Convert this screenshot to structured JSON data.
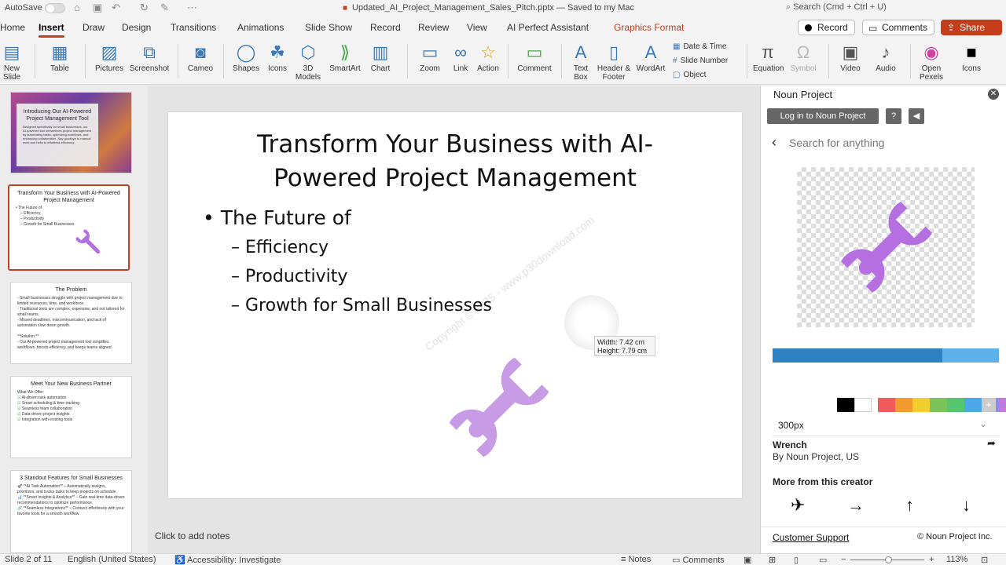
{
  "titlebar": {
    "autosave_label": "AutoSave",
    "doc_title": "Updated_AI_Project_Management_Sales_Pitch.pptx",
    "save_status": "— Saved to my Mac",
    "search_placeholder": "Search (Cmd + Ctrl + U)"
  },
  "tabs": [
    "Home",
    "Insert",
    "Draw",
    "Design",
    "Transitions",
    "Animations",
    "Slide Show",
    "Record",
    "Review",
    "View",
    "AI Perfect Assistant",
    "Graphics Format"
  ],
  "active_tab": "Insert",
  "actions": {
    "record": "Record",
    "comments": "Comments",
    "share": "Share"
  },
  "ribbon": {
    "new_slide": "New\nSlide",
    "table": "Table",
    "pictures": "Pictures",
    "screenshot": "Screenshot",
    "cameo": "Cameo",
    "shapes": "Shapes",
    "icons": "Icons",
    "models3d": "3D\nModels",
    "smartart": "SmartArt",
    "chart": "Chart",
    "zoom": "Zoom",
    "link": "Link",
    "action": "Action",
    "comment": "Comment",
    "textbox": "Text\nBox",
    "header_footer": "Header &\nFooter",
    "wordart": "WordArt",
    "date_time": "Date & Time",
    "slide_number": "Slide Number",
    "object": "Object",
    "equation": "Equation",
    "symbol": "Symbol",
    "video": "Video",
    "audio": "Audio",
    "open_pexels": "Open\nPexels",
    "icons2": "Icons"
  },
  "thumbnails": {
    "s1": {
      "title": "Introducing Our AI-Powered Project Management Tool",
      "body": "Designed specifically for small businesses, our AI-powered tool streamlines project management by automating tasks, optimizing workflows, and enhancing collaboration. Say goodbye to manual work and hello to effortless efficiency."
    },
    "s2": {
      "title": "Transform Your Business with AI-Powered Project Management",
      "b1": "• The Future of",
      "b2": "– Efficiency",
      "b3": "– Productivity",
      "b4": "– Growth for Small Businesses"
    },
    "s3": {
      "title": "The Problem",
      "body": "- Small businesses struggle with project management due to limited resources, time, and workforce.\n- Traditional tools are complex, expensive, and not tailored for small teams.\n- Missed deadlines, miscommunication, and lack of automation slow down growth.\n\n**Solution:**\n- Our AI-powered project management tool simplifies workflows, boosts efficiency, and keeps teams aligned."
    },
    "s4": {
      "title": "Meet Your New Business Partner",
      "h": "What We Offer:",
      "items": [
        "AI-driven task automation",
        "Smart scheduling & time tracking",
        "Seamless team collaboration",
        "Data-driven project insights",
        "Integration with existing tools"
      ]
    },
    "s5": {
      "title": "3 Standout Features for Small Businesses",
      "body": "🚀 **AI Task Automation** – Automatically assigns, prioritizes, and tracks tasks to keep projects on schedule.\n📊 **Smart Insights & Analytics** – Gain real-time data-driven recommendations to optimize performance.\n🔗 **Seamless Integrations** – Connect effortlessly with your favorite tools for a smooth workflow."
    }
  },
  "slide": {
    "title": "Transform Your Business with AI-Powered Project Management",
    "bullet": "The Future of",
    "subs": [
      "– Efficiency",
      "– Productivity",
      "– Growth for Small Businesses"
    ],
    "watermark": "Copyright © 2025 - www.p30download.com"
  },
  "size_tooltip": {
    "width": "Width: 7.42 cm",
    "height": "Height: 7.79 cm"
  },
  "notes_placeholder": "Click to add notes",
  "noun_panel": {
    "title": "Noun Project",
    "login": "Log in to Noun Project",
    "search_placeholder": "Search for anything",
    "progress": 0.75,
    "colors": [
      "#000000",
      "#ffffff",
      "#f05a5a",
      "#f29a2e",
      "#f2cd2e",
      "#7cc35a",
      "#54c76e",
      "#4aa8e8",
      "#8e8ef0",
      "#c37adb"
    ],
    "size": "300px",
    "icon_name": "Wrench",
    "icon_by": "By Noun Project, US",
    "more_label": "More from this creator",
    "support": "Customer Support",
    "copyright": "© Noun Project Inc."
  },
  "statusbar": {
    "slide_of": "Slide 2 of 11",
    "language": "English (United States)",
    "accessibility": "Accessibility: Investigate",
    "notes": "Notes",
    "comments": "Comments",
    "zoom": "113%"
  },
  "colors": {
    "accent": "#c43e1c",
    "wrench": "#b56fe0",
    "wrench_light": "#c89be6"
  }
}
